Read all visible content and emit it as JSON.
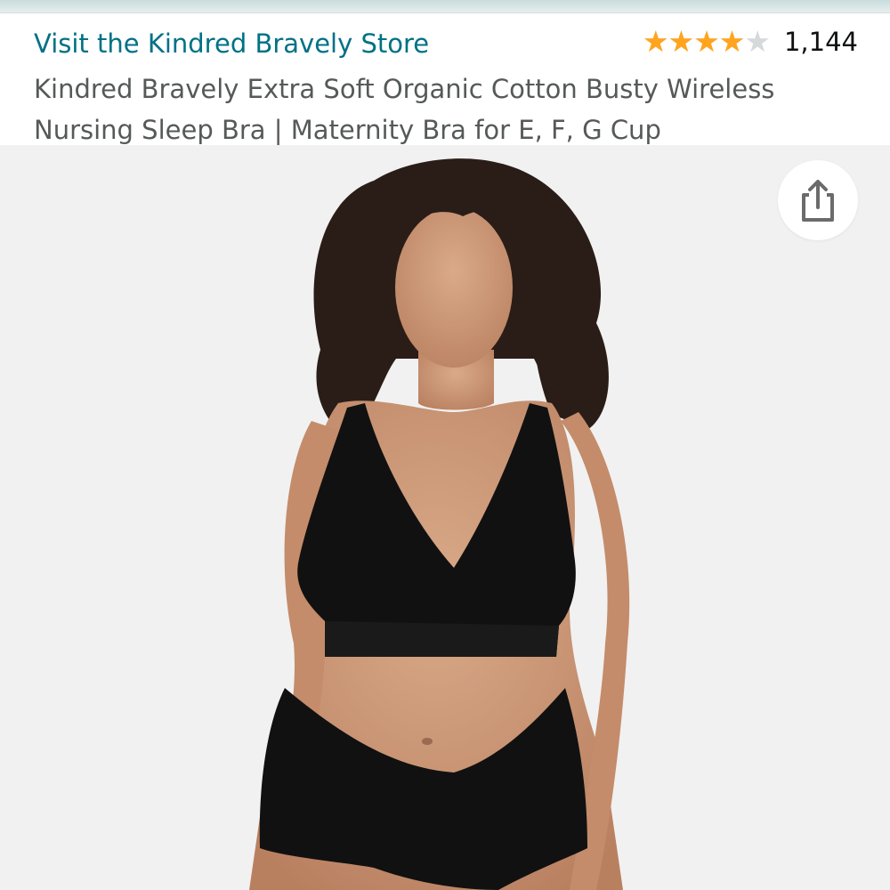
{
  "store": {
    "link_text": "Visit the Kindred Bravely Store",
    "link_color": "#007185"
  },
  "rating": {
    "stars_out_of_5": 4.0,
    "review_count": "1,144",
    "star_color": "#ffa41c"
  },
  "product": {
    "title": "Kindred Bravely Extra Soft Organic Cotton Busty Wireless Nursing Sleep Bra | Maternity Bra for E, F, G Cup"
  },
  "gallery": {
    "share_icon": "share-icon",
    "image_subject": "model wearing black nursing sleep bra and black underwear"
  }
}
